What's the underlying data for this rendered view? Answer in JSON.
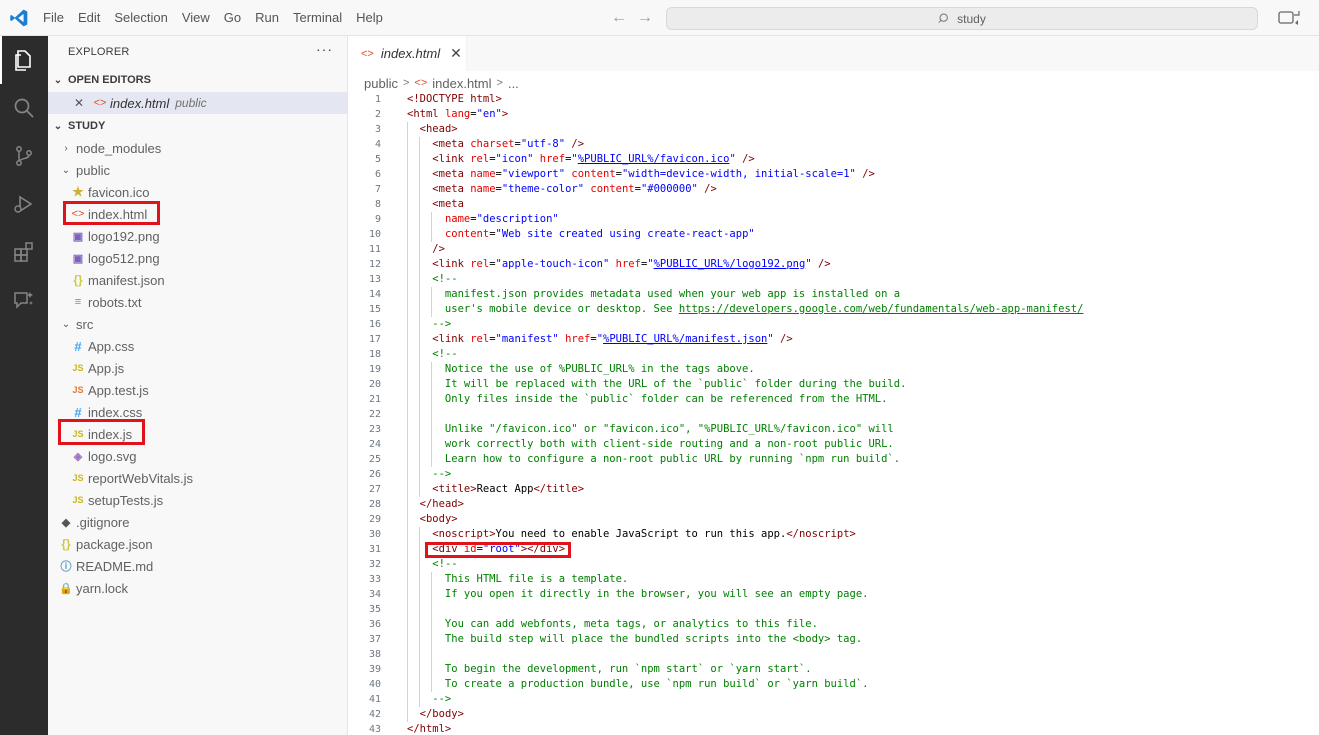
{
  "menu": [
    "File",
    "Edit",
    "Selection",
    "View",
    "Go",
    "Run",
    "Terminal",
    "Help"
  ],
  "search_text": "study",
  "sidebar": {
    "title": "EXPLORER",
    "more": "···",
    "open_editors_header": "OPEN EDITORS",
    "open_editor": {
      "close": "✕",
      "name": "index.html",
      "desc": "public"
    },
    "workspace_header": "STUDY"
  },
  "tree": [
    {
      "label": "node_modules",
      "depth": 1,
      "type": "folder-closed",
      "icon": "›"
    },
    {
      "label": "public",
      "depth": 1,
      "type": "folder-open",
      "icon": "⌄"
    },
    {
      "label": "favicon.ico",
      "depth": 2,
      "type": "star",
      "icon": "★"
    },
    {
      "label": "index.html",
      "depth": 2,
      "type": "html",
      "icon": "<>"
    },
    {
      "label": "logo192.png",
      "depth": 2,
      "type": "img",
      "icon": "▣"
    },
    {
      "label": "logo512.png",
      "depth": 2,
      "type": "img",
      "icon": "▣"
    },
    {
      "label": "manifest.json",
      "depth": 2,
      "type": "json",
      "icon": "{}"
    },
    {
      "label": "robots.txt",
      "depth": 2,
      "type": "txt",
      "icon": "≡"
    },
    {
      "label": "src",
      "depth": 1,
      "type": "folder-open",
      "icon": "⌄"
    },
    {
      "label": "App.css",
      "depth": 2,
      "type": "css",
      "icon": "#"
    },
    {
      "label": "App.js",
      "depth": 2,
      "type": "js",
      "icon": "JS"
    },
    {
      "label": "App.test.js",
      "depth": 2,
      "type": "jstest",
      "icon": "JS"
    },
    {
      "label": "index.css",
      "depth": 2,
      "type": "css",
      "icon": "#"
    },
    {
      "label": "index.js",
      "depth": 2,
      "type": "js",
      "icon": "JS"
    },
    {
      "label": "logo.svg",
      "depth": 2,
      "type": "svg",
      "icon": "◈"
    },
    {
      "label": "reportWebVitals.js",
      "depth": 2,
      "type": "js",
      "icon": "JS"
    },
    {
      "label": "setupTests.js",
      "depth": 2,
      "type": "js",
      "icon": "JS"
    },
    {
      "label": ".gitignore",
      "depth": 1,
      "type": "git",
      "icon": "◆"
    },
    {
      "label": "package.json",
      "depth": 1,
      "type": "json",
      "icon": "{}"
    },
    {
      "label": "README.md",
      "depth": 1,
      "type": "md",
      "icon": "ⓘ"
    },
    {
      "label": "yarn.lock",
      "depth": 1,
      "type": "yarn",
      "icon": "🔒"
    }
  ],
  "tab": {
    "icon": "<>",
    "label": "index.html",
    "close": "✕"
  },
  "breadcrumb": [
    "public",
    "index.html",
    "..."
  ],
  "code": [
    [
      [
        "t",
        "<!DOCTYPE html>"
      ]
    ],
    [
      [
        "t",
        "<html "
      ],
      [
        "a",
        "lang"
      ],
      [
        "x",
        "="
      ],
      [
        "v",
        "\"en\""
      ],
      [
        "t",
        ">"
      ]
    ],
    [
      [
        "x",
        "  "
      ],
      [
        "t",
        "<head>"
      ]
    ],
    [
      [
        "x",
        "    "
      ],
      [
        "t",
        "<meta "
      ],
      [
        "a",
        "charset"
      ],
      [
        "x",
        "="
      ],
      [
        "v",
        "\"utf-8\""
      ],
      [
        "t",
        " />"
      ]
    ],
    [
      [
        "x",
        "    "
      ],
      [
        "t",
        "<link "
      ],
      [
        "a",
        "rel"
      ],
      [
        "x",
        "="
      ],
      [
        "v",
        "\"icon\""
      ],
      [
        "a",
        " href"
      ],
      [
        "x",
        "="
      ],
      [
        "v",
        "\""
      ],
      [
        "vu",
        "%PUBLIC_URL%/favicon.ico"
      ],
      [
        "v",
        "\""
      ],
      [
        "t",
        " />"
      ]
    ],
    [
      [
        "x",
        "    "
      ],
      [
        "t",
        "<meta "
      ],
      [
        "a",
        "name"
      ],
      [
        "x",
        "="
      ],
      [
        "v",
        "\"viewport\""
      ],
      [
        "a",
        " content"
      ],
      [
        "x",
        "="
      ],
      [
        "v",
        "\"width=device-width, initial-scale=1\""
      ],
      [
        "t",
        " />"
      ]
    ],
    [
      [
        "x",
        "    "
      ],
      [
        "t",
        "<meta "
      ],
      [
        "a",
        "name"
      ],
      [
        "x",
        "="
      ],
      [
        "v",
        "\"theme-color\""
      ],
      [
        "a",
        " content"
      ],
      [
        "x",
        "="
      ],
      [
        "v",
        "\"#000000\""
      ],
      [
        "t",
        " />"
      ]
    ],
    [
      [
        "x",
        "    "
      ],
      [
        "t",
        "<meta"
      ]
    ],
    [
      [
        "x",
        "      "
      ],
      [
        "a",
        "name"
      ],
      [
        "x",
        "="
      ],
      [
        "v",
        "\"description\""
      ]
    ],
    [
      [
        "x",
        "      "
      ],
      [
        "a",
        "content"
      ],
      [
        "x",
        "="
      ],
      [
        "v",
        "\"Web site created using create-react-app\""
      ]
    ],
    [
      [
        "x",
        "    "
      ],
      [
        "t",
        "/>"
      ]
    ],
    [
      [
        "x",
        "    "
      ],
      [
        "t",
        "<link "
      ],
      [
        "a",
        "rel"
      ],
      [
        "x",
        "="
      ],
      [
        "v",
        "\"apple-touch-icon\""
      ],
      [
        "a",
        " href"
      ],
      [
        "x",
        "="
      ],
      [
        "v",
        "\""
      ],
      [
        "vu",
        "%PUBLIC_URL%/logo192.png"
      ],
      [
        "v",
        "\""
      ],
      [
        "t",
        " />"
      ]
    ],
    [
      [
        "x",
        "    "
      ],
      [
        "c",
        "<!--"
      ]
    ],
    [
      [
        "c",
        "      manifest.json provides metadata used when your web app is installed on a"
      ]
    ],
    [
      [
        "c",
        "      user's mobile device or desktop. See "
      ],
      [
        "cu",
        "https://developers.google.com/web/fundamentals/web-app-manifest/"
      ]
    ],
    [
      [
        "c",
        "    -->"
      ]
    ],
    [
      [
        "x",
        "    "
      ],
      [
        "t",
        "<link "
      ],
      [
        "a",
        "rel"
      ],
      [
        "x",
        "="
      ],
      [
        "v",
        "\"manifest\""
      ],
      [
        "a",
        " href"
      ],
      [
        "x",
        "="
      ],
      [
        "v",
        "\""
      ],
      [
        "vu",
        "%PUBLIC_URL%/manifest.json"
      ],
      [
        "v",
        "\""
      ],
      [
        "t",
        " />"
      ]
    ],
    [
      [
        "x",
        "    "
      ],
      [
        "c",
        "<!--"
      ]
    ],
    [
      [
        "c",
        "      Notice the use of %PUBLIC_URL% in the tags above."
      ]
    ],
    [
      [
        "c",
        "      It will be replaced with the URL of the `public` folder during the build."
      ]
    ],
    [
      [
        "c",
        "      Only files inside the `public` folder can be referenced from the HTML."
      ]
    ],
    [
      [
        "c",
        ""
      ]
    ],
    [
      [
        "c",
        "      Unlike \"/favicon.ico\" or \"favicon.ico\", \"%PUBLIC_URL%/favicon.ico\" will"
      ]
    ],
    [
      [
        "c",
        "      work correctly both with client-side routing and a non-root public URL."
      ]
    ],
    [
      [
        "c",
        "      Learn how to configure a non-root public URL by running `npm run build`."
      ]
    ],
    [
      [
        "c",
        "    -->"
      ]
    ],
    [
      [
        "x",
        "    "
      ],
      [
        "t",
        "<title>"
      ],
      [
        "x",
        "React App"
      ],
      [
        "t",
        "</title>"
      ]
    ],
    [
      [
        "x",
        "  "
      ],
      [
        "t",
        "</head>"
      ]
    ],
    [
      [
        "x",
        "  "
      ],
      [
        "t",
        "<body>"
      ]
    ],
    [
      [
        "x",
        "    "
      ],
      [
        "t",
        "<noscript>"
      ],
      [
        "x",
        "You need to enable JavaScript to run this app."
      ],
      [
        "t",
        "</noscript>"
      ]
    ],
    [
      [
        "x",
        "    "
      ],
      [
        "t",
        "<div "
      ],
      [
        "a",
        "id"
      ],
      [
        "x",
        "="
      ],
      [
        "v",
        "\"root\""
      ],
      [
        "t",
        "></div>"
      ]
    ],
    [
      [
        "x",
        "    "
      ],
      [
        "c",
        "<!--"
      ]
    ],
    [
      [
        "c",
        "      This HTML file is a template."
      ]
    ],
    [
      [
        "c",
        "      If you open it directly in the browser, you will see an empty page."
      ]
    ],
    [
      [
        "c",
        ""
      ]
    ],
    [
      [
        "c",
        "      You can add webfonts, meta tags, or analytics to this file."
      ]
    ],
    [
      [
        "c",
        "      The build step will place the bundled scripts into the <body> tag."
      ]
    ],
    [
      [
        "c",
        ""
      ]
    ],
    [
      [
        "c",
        "      To begin the development, run `npm start` or `yarn start`."
      ]
    ],
    [
      [
        "c",
        "      To create a production bundle, use `npm run build` or `yarn build`."
      ]
    ],
    [
      [
        "c",
        "    -->"
      ]
    ],
    [
      [
        "x",
        "  "
      ],
      [
        "t",
        "</body>"
      ]
    ],
    [
      [
        "t",
        "</html>"
      ]
    ]
  ]
}
